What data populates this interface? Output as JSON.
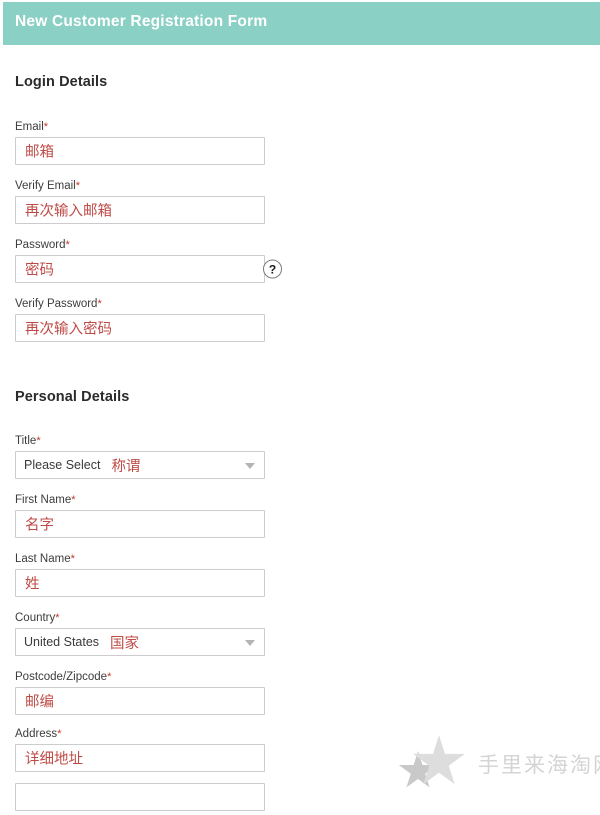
{
  "header": {
    "title": "New Customer Registration Form",
    "background_color": "#8bd0c4",
    "title_color": "#ffffff"
  },
  "colors": {
    "annotation_red": "#bf4b46",
    "required_asterisk": "#c0392b",
    "input_border": "#cccccc",
    "heading": "#2b2b2b",
    "label": "#3c3c3c",
    "select_arrow": "#b4b4b4",
    "watermark": "#d4d4d4"
  },
  "sections": [
    {
      "id": "login-details",
      "heading": "Login Details",
      "fields": [
        {
          "id": "email",
          "label": "Email",
          "required_marker": "*",
          "type": "text",
          "annotation": "邮箱",
          "help_icon": null
        },
        {
          "id": "verify-email",
          "label": "Verify Email",
          "required_marker": "*",
          "type": "text",
          "annotation": "再次输入邮箱",
          "help_icon": null
        },
        {
          "id": "password",
          "label": "Password",
          "required_marker": "*",
          "type": "text",
          "annotation": "密码",
          "help_icon": "?"
        },
        {
          "id": "verify-password",
          "label": "Verify Password",
          "required_marker": "*",
          "type": "text",
          "annotation": "再次输入密码",
          "help_icon": null
        }
      ]
    },
    {
      "id": "personal-details",
      "heading": "Personal Details",
      "fields": [
        {
          "id": "title",
          "label": "Title",
          "required_marker": "*",
          "type": "select",
          "value": "Please Select",
          "annotation": "称谓"
        },
        {
          "id": "first-name",
          "label": "First Name",
          "required_marker": "*",
          "type": "text",
          "annotation": "名字",
          "help_icon": null
        },
        {
          "id": "last-name",
          "label": "Last Name",
          "required_marker": "*",
          "type": "text",
          "annotation": "姓",
          "help_icon": null
        },
        {
          "id": "country",
          "label": "Country",
          "required_marker": "*",
          "type": "select",
          "value": "United States",
          "annotation": "国家"
        },
        {
          "id": "postcode",
          "label": "Postcode/Zipcode",
          "required_marker": "*",
          "type": "text",
          "annotation": "邮编",
          "help_icon": null
        },
        {
          "id": "address-line-1",
          "label": "Address",
          "required_marker": "*",
          "type": "text",
          "annotation": "详细地址",
          "help_icon": null
        },
        {
          "id": "address-line-2",
          "label": "",
          "required_marker": "",
          "type": "text",
          "annotation": "",
          "help_icon": null
        }
      ]
    }
  ],
  "watermark": {
    "text": "手里来海淘网",
    "icon": "double-star-icon"
  }
}
